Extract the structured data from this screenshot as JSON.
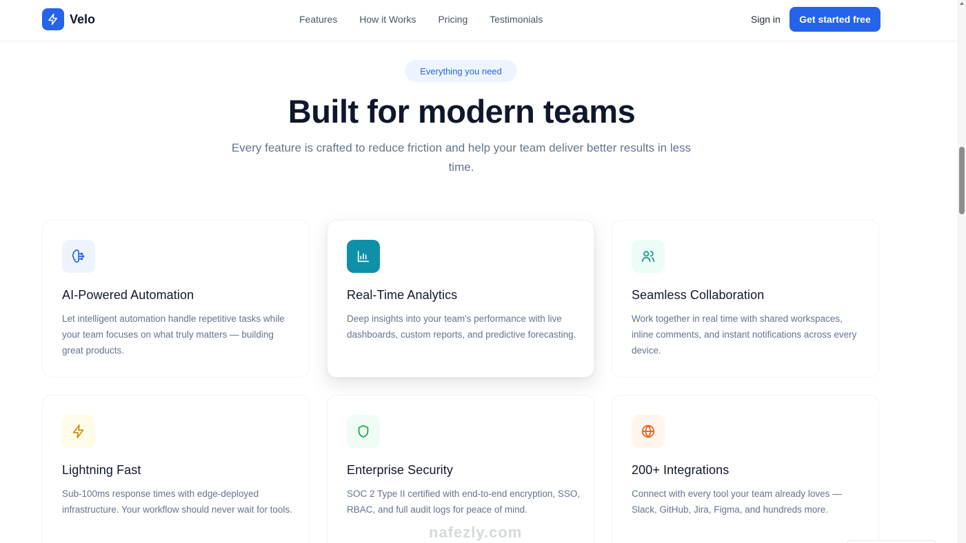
{
  "nav": {
    "brand": "Velo",
    "links": [
      "Features",
      "How it Works",
      "Pricing",
      "Testimonials"
    ],
    "signin": "Sign in",
    "cta": "Get started free"
  },
  "hero": {
    "badge": "Everything you need",
    "title": "Built for modern teams",
    "subtitle": "Every feature is crafted to reduce friction and help your team deliver better results in less time."
  },
  "features": [
    {
      "icon": "brain-icon",
      "title": "AI-Powered Automation",
      "text": "Let intelligent automation handle repetitive tasks while your team focuses on what truly matters — building great products.",
      "icon_bg": "#eef4ff",
      "icon_color": "#2563eb"
    },
    {
      "icon": "bar-chart-icon",
      "title": "Real-Time Analytics",
      "text": "Deep insights into your team's performance with live dashboards, custom reports, and predictive forecasting.",
      "icon_bg": "#0e90a8",
      "icon_color": "#ffffff"
    },
    {
      "icon": "users-icon",
      "title": "Seamless Collaboration",
      "text": "Work together in real time with shared workspaces, inline comments, and instant notifications across every device.",
      "icon_bg": "#ecfdf7",
      "icon_color": "#0d9488"
    },
    {
      "icon": "lightning-icon",
      "title": "Lightning Fast",
      "text": "Sub-100ms response times with edge-deployed infrastructure. Your workflow should never wait for tools.",
      "icon_bg": "#fefbe8",
      "icon_color": "#ca8a04"
    },
    {
      "icon": "shield-icon",
      "title": "Enterprise Security",
      "text": "SOC 2 Type II certified with end-to-end encryption, SSO, RBAC, and full audit logs for peace of mind.",
      "icon_bg": "#effdf4",
      "icon_color": "#16a34a"
    },
    {
      "icon": "globe-icon",
      "title": "200+ Integrations",
      "text": "Connect with every tool your team already loves — Slack, GitHub, Jira, Figma, and hundreds more.",
      "icon_bg": "#fff5ec",
      "icon_color": "#ea580c"
    }
  ],
  "watermark": "nafezly.com",
  "colors": {
    "accent": "#2563eb",
    "heading": "#0f172a",
    "muted": "#64748b"
  }
}
